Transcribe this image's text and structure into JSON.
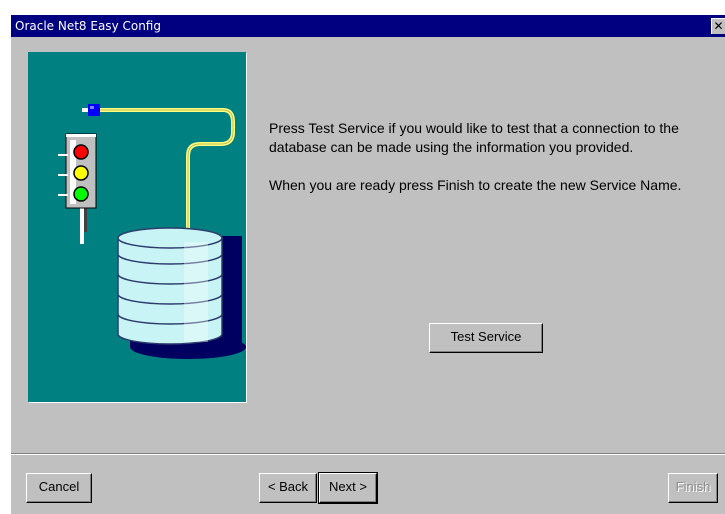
{
  "window": {
    "title": "Oracle Net8 Easy Config",
    "close_label": "✕"
  },
  "illustration": {
    "icons": [
      "traffic-light-icon",
      "network-plug-icon",
      "database-icon"
    ],
    "colors": {
      "panel": "#008080",
      "red": "#ff0000",
      "yellow": "#ffff00",
      "green": "#00ff00",
      "plug": "#0000ff",
      "cable": "#ffff80",
      "db": "#b8eef0"
    }
  },
  "message": {
    "paragraph1": "Press Test Service if you would like to test that a connection to the database can be made using the information you provided.",
    "paragraph2": "When you are ready press Finish to create the new Service Name."
  },
  "buttons": {
    "test_service": "Test Service",
    "cancel": "Cancel",
    "back": "< Back",
    "next": "Next >",
    "finish": "Finish"
  }
}
